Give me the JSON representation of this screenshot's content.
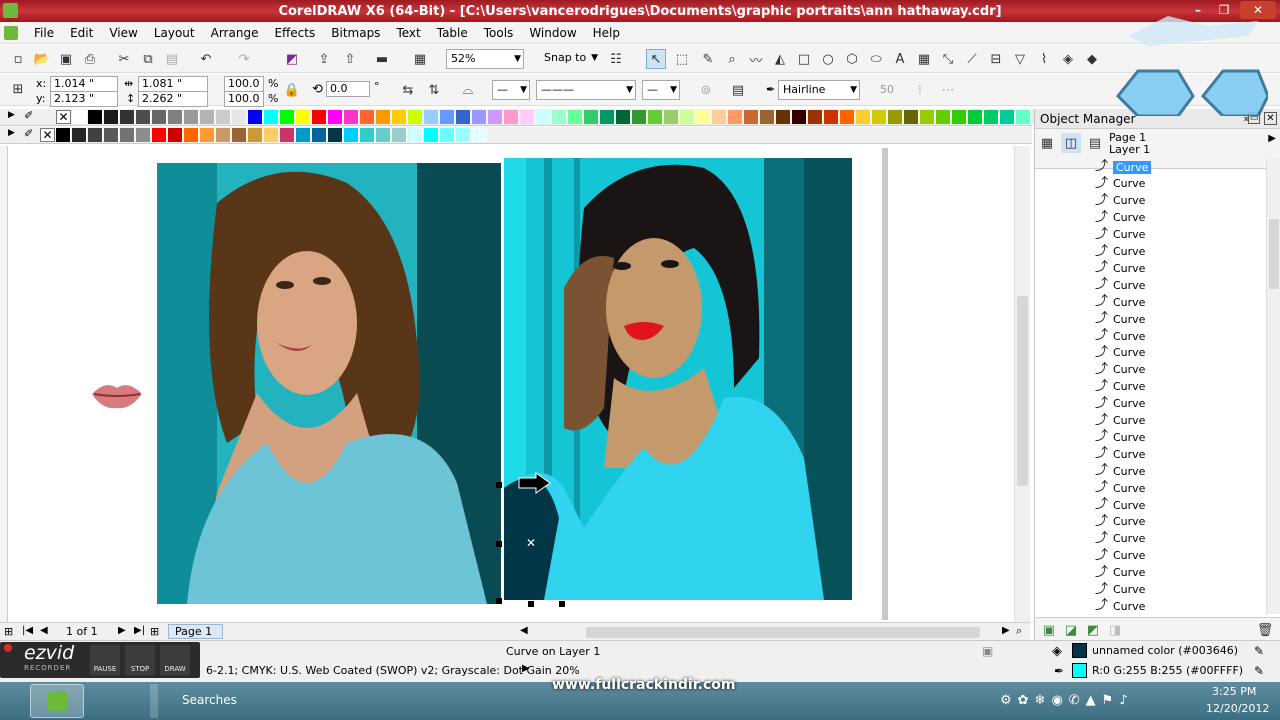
{
  "window": {
    "title": "CorelDRAW X6 (64-Bit) - [C:\\Users\\vancerodrigues\\Documents\\graphic portraits\\ann hathaway.cdr]",
    "controls": [
      "–",
      "❐",
      "✕"
    ]
  },
  "menu": [
    "File",
    "Edit",
    "View",
    "Layout",
    "Arrange",
    "Effects",
    "Bitmaps",
    "Text",
    "Table",
    "Tools",
    "Window",
    "Help"
  ],
  "toolbar": {
    "zoom": "52%",
    "snap_to": "Snap to"
  },
  "property_bar": {
    "x_label": "x:",
    "x_value": "1.014 \"",
    "y_label": "y:",
    "y_value": "2.123 \"",
    "w_value": "1.081 \"",
    "h_value": "2.262 \"",
    "scale_x": "100.0",
    "scale_y": "100.0",
    "percent": "%",
    "rotation": "0.0",
    "degree": "°",
    "outline_width": "Hairline",
    "miter": "50"
  },
  "palette_row1": [
    "#ffffff",
    "#000000",
    "#1a1a1a",
    "#333333",
    "#4d4d4d",
    "#666666",
    "#808080",
    "#999999",
    "#b3b3b3",
    "#cccccc",
    "#e6e6e6",
    "#0000ff",
    "#00ffff",
    "#00ff00",
    "#ffff00",
    "#ff0000",
    "#ff00ff",
    "#ff33cc",
    "#ff6633",
    "#ff9900",
    "#ffcc00",
    "#ccff00",
    "#99ccff",
    "#6699ff",
    "#3366cc",
    "#9999ff",
    "#cc99ff",
    "#ff99cc",
    "#ffccff",
    "#ccffff",
    "#99ffcc",
    "#66ff99",
    "#33cc66",
    "#009966",
    "#006633",
    "#339933",
    "#66cc33",
    "#99cc66",
    "#ccff99",
    "#ffff99",
    "#ffcc99",
    "#ff9966",
    "#cc6633",
    "#996633",
    "#663300",
    "#330000",
    "#993300",
    "#cc3300",
    "#ff6600",
    "#ffcc33",
    "#cccc00",
    "#999900",
    "#666600",
    "#99cc00",
    "#66cc00",
    "#33cc00",
    "#00cc33",
    "#00cc66",
    "#00cc99",
    "#66ffcc",
    "#ccffcc",
    "#e0f0c0"
  ],
  "palette_row2": [
    "#000000",
    "#262626",
    "#404040",
    "#595959",
    "#737373",
    "#8c8c8c",
    "#ff0000",
    "#cc0000",
    "#ff6600",
    "#ff9933",
    "#cc9966",
    "#996633",
    "#cc9933",
    "#ffcc66",
    "#cc3366",
    "#0099cc",
    "#006699",
    "#003646",
    "#00ccff",
    "#33cccc",
    "#66cccc",
    "#99cccc",
    "#ccffff",
    "#00ffff",
    "#66ffff",
    "#99ffff",
    "#e5ffff"
  ],
  "object_manager": {
    "title": "Object Manager",
    "page": "Page 1",
    "layer": "Layer 1",
    "items": [
      "Curve",
      "Curve",
      "Curve",
      "Curve",
      "Curve",
      "Curve",
      "Curve",
      "Curve",
      "Curve",
      "Curve",
      "Curve",
      "Curve",
      "Curve",
      "Curve",
      "Curve",
      "Curve",
      "Curve",
      "Curve",
      "Curve",
      "Curve",
      "Curve",
      "Curve",
      "Curve",
      "Curve",
      "Curve",
      "Curve",
      "Curve"
    ]
  },
  "page_nav": {
    "count": "1 of 1",
    "tab": "Page 1"
  },
  "status": {
    "object_info": "Curve on Layer 1",
    "color_profile": "6-2.1; CMYK: U.S. Web Coated (SWOP) v2; Grayscale: Dot Gain 20%",
    "fill_label": "unnamed color (#003646)",
    "fill_color": "#003646",
    "outline_label": "R:0 G:255 B:255 (#00FFFF)",
    "outline_color": "#00ffff"
  },
  "ezvid": {
    "brand": "ezvid",
    "sub": "RECORDER",
    "buttons": [
      "PAUSE",
      "STOP",
      "DRAW"
    ]
  },
  "taskbar": {
    "search": "Searches",
    "time": "3:25 PM",
    "date": "12/20/2012"
  },
  "watermark": "www.fullcrackindir.com"
}
